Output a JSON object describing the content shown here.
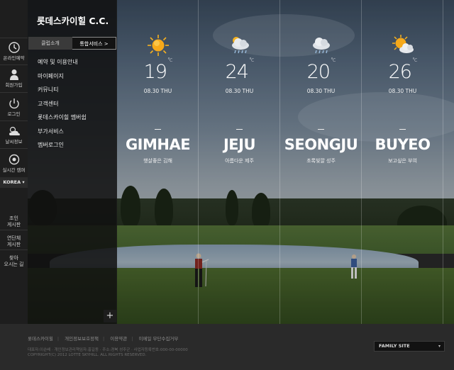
{
  "site": {
    "logo": "롯데스카이힐 C.C."
  },
  "iconbar": {
    "items": [
      {
        "label": "온라인예약",
        "icon": "clock-icon"
      },
      {
        "label": "회원가입",
        "icon": "person-icon"
      },
      {
        "label": "로그인",
        "icon": "power-icon"
      },
      {
        "label": "날씨정보",
        "icon": "weather-icon"
      },
      {
        "label": "실시간 캠퍼",
        "icon": "camera-icon"
      }
    ],
    "language": "KOREA",
    "bottom": [
      {
        "line1": "조인",
        "line2": "게시판"
      },
      {
        "line1": "연단체",
        "line2": "게시판"
      },
      {
        "line1": "찾아",
        "line2": "오시는 길"
      }
    ]
  },
  "menu": {
    "tabs": [
      "클럽소개",
      "통합서비스 >"
    ],
    "items": [
      "예약 및 이용안내",
      "마이페이지",
      "커뮤니티",
      "고객센터",
      "롯데스카이힐 멤버쉽",
      "부가서비스",
      "멤버로그인"
    ]
  },
  "weather": [
    {
      "temp": "19",
      "unit": "°c",
      "date": "08.30 THU",
      "city": "GIMHAE",
      "sub": "햇살좋은 김해",
      "icon": "sun-icon"
    },
    {
      "temp": "24",
      "unit": "°c",
      "date": "08.30 THU",
      "city": "JEJU",
      "sub": "아름다운 제주",
      "icon": "rain-cloud-icon"
    },
    {
      "temp": "20",
      "unit": "°c",
      "date": "08.30 THU",
      "city": "SEONGJU",
      "sub": "초록빛깔 성주",
      "icon": "rain-cloud-icon"
    },
    {
      "temp": "26",
      "unit": "°c",
      "date": "08.30 THU",
      "city": "BUYEO",
      "sub": "보고싶은 부여",
      "icon": "sun-cloud-icon"
    }
  ],
  "expand_label": "+",
  "footer": {
    "links": [
      "롯데스카이힐",
      "개인정보보호정책",
      "이용약관",
      "이메일 무단수집거부"
    ],
    "address": "대표자:이순배 · 개인정보관리책임자:홍길동 · 주소:경북 성주군 · 사업자등록번호:000-00-00000",
    "copyright": "COPYRIGHT(C) 2012 LOTTE SKYHILL. ALL RIGHTS RESERVED.",
    "family_site": "FAMILY SITE"
  },
  "colors": {
    "sun": "#f6b21f",
    "menu_bg": "#101010",
    "footer_bg": "#2a2a2a"
  }
}
